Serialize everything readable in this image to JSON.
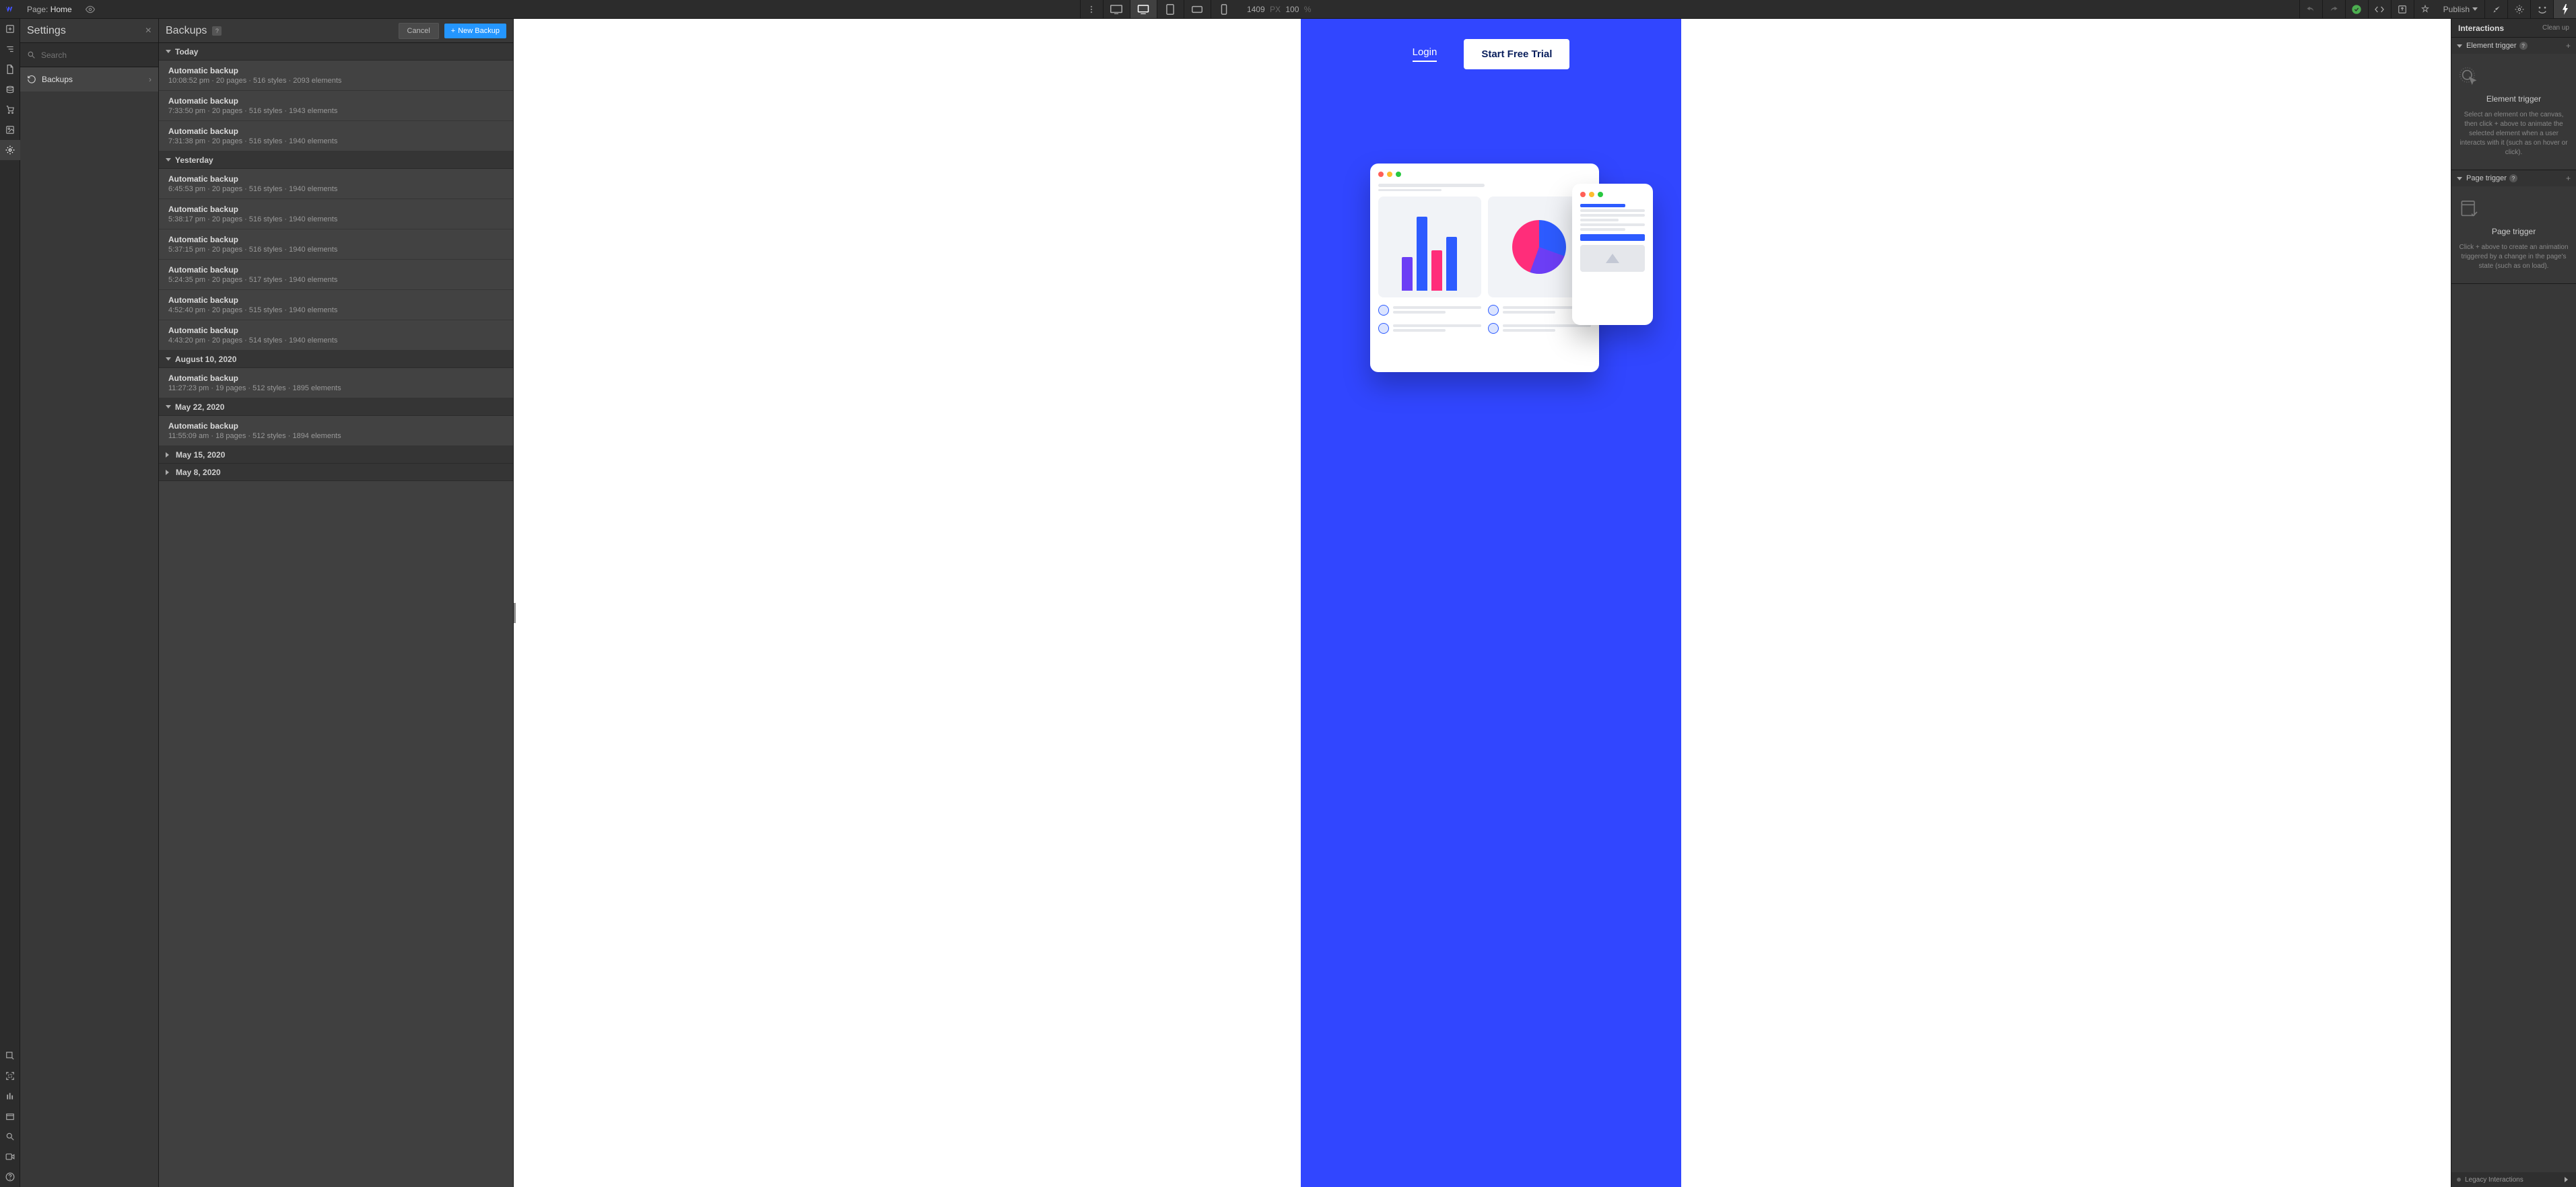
{
  "topbar": {
    "page_label": "Page:",
    "page_name": "Home",
    "width": "1409",
    "width_unit": "PX",
    "zoom": "100",
    "zoom_unit": "%",
    "publish": "Publish"
  },
  "settings": {
    "title": "Settings",
    "search_placeholder": "Search",
    "items": {
      "backups": "Backups"
    }
  },
  "backups": {
    "title": "Backups",
    "cancel": "Cancel",
    "new": "New Backup",
    "groups": [
      {
        "label": "Today",
        "open": true,
        "items": [
          {
            "title": "Automatic backup",
            "meta": "10:08:52 pm · 20 pages · 516 styles · 2093 elements"
          },
          {
            "title": "Automatic backup",
            "meta": "7:33:50 pm · 20 pages · 516 styles · 1943 elements"
          },
          {
            "title": "Automatic backup",
            "meta": "7:31:38 pm · 20 pages · 516 styles · 1940 elements"
          }
        ]
      },
      {
        "label": "Yesterday",
        "open": true,
        "items": [
          {
            "title": "Automatic backup",
            "meta": "6:45:53 pm · 20 pages · 516 styles · 1940 elements"
          },
          {
            "title": "Automatic backup",
            "meta": "5:38:17 pm · 20 pages · 516 styles · 1940 elements"
          },
          {
            "title": "Automatic backup",
            "meta": "5:37:15 pm · 20 pages · 516 styles · 1940 elements"
          },
          {
            "title": "Automatic backup",
            "meta": "5:24:35 pm · 20 pages · 517 styles · 1940 elements"
          },
          {
            "title": "Automatic backup",
            "meta": "4:52:40 pm · 20 pages · 515 styles · 1940 elements"
          },
          {
            "title": "Automatic backup",
            "meta": "4:43:20 pm · 20 pages · 514 styles · 1940 elements"
          }
        ]
      },
      {
        "label": "August 10, 2020",
        "open": true,
        "items": [
          {
            "title": "Automatic backup",
            "meta": "11:27:23 pm · 19 pages · 512 styles · 1895 elements"
          }
        ]
      },
      {
        "label": "May 22, 2020",
        "open": true,
        "items": [
          {
            "title": "Automatic backup",
            "meta": "11:55:09 am · 18 pages · 512 styles · 1894 elements"
          }
        ]
      },
      {
        "label": "May 15, 2020",
        "open": false,
        "items": []
      },
      {
        "label": "May 8, 2020",
        "open": false,
        "items": []
      }
    ]
  },
  "canvas": {
    "login": "Login",
    "cta": "Start Free Trial"
  },
  "interactions": {
    "title": "Interactions",
    "cleanup": "Clean up",
    "element_trigger": {
      "label": "Element trigger",
      "heading": "Element trigger",
      "desc": "Select an element on the canvas, then click + above to animate the selected element when a user interacts with it (such as on hover or click)."
    },
    "page_trigger": {
      "label": "Page trigger",
      "heading": "Page trigger",
      "desc": "Click + above to create an animation triggered by a change in the page's state (such as on load)."
    },
    "legacy": "Legacy Interactions"
  }
}
